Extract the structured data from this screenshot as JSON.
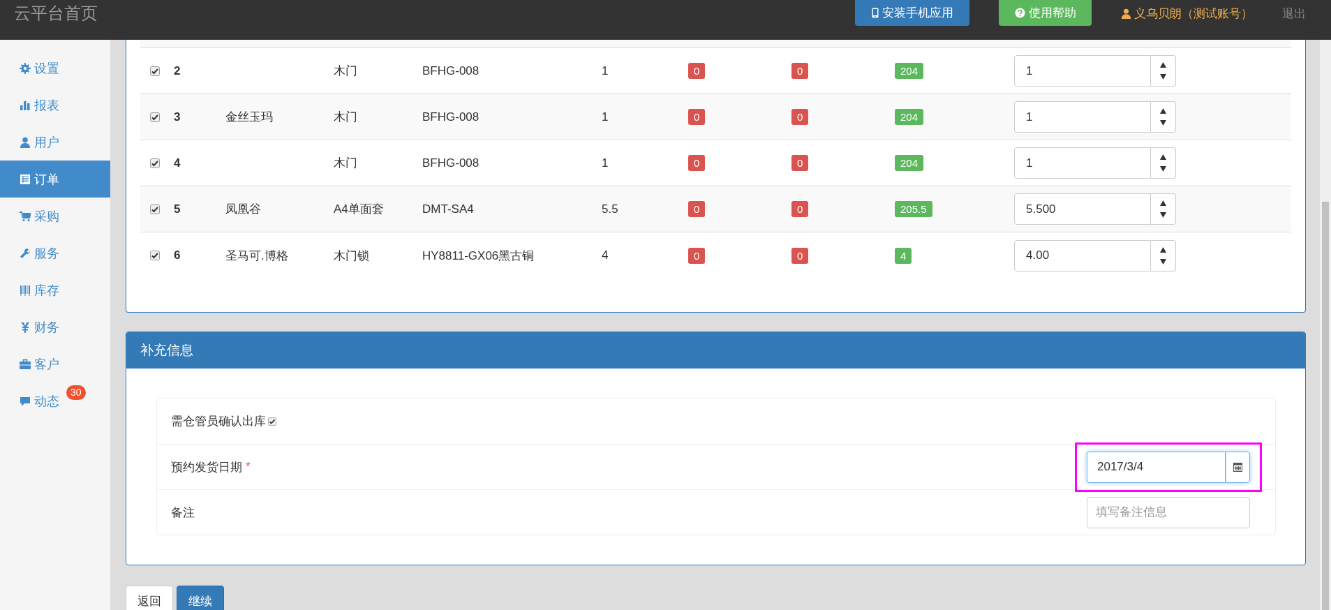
{
  "header": {
    "title": "云平台首页",
    "buttons": [
      {
        "label": "安装手机应用",
        "kind": "primary"
      },
      {
        "label": "使用帮助",
        "kind": "success"
      }
    ],
    "user": "义乌贝朗（测试账号）",
    "logout": "退出"
  },
  "sidebar": {
    "items": [
      {
        "label": "设置",
        "kind": "settings",
        "selected": false
      },
      {
        "label": "报表",
        "kind": "reports",
        "selected": false
      },
      {
        "label": "用户",
        "kind": "users",
        "selected": false
      },
      {
        "label": "订单",
        "kind": "orders",
        "selected": true
      },
      {
        "label": "采购",
        "kind": "purchase",
        "selected": false
      },
      {
        "label": "服务",
        "kind": "service",
        "selected": false
      },
      {
        "label": "库存",
        "kind": "stock",
        "selected": false
      },
      {
        "label": "财务",
        "kind": "finance",
        "selected": false
      },
      {
        "label": "客户",
        "kind": "clients",
        "selected": false
      },
      {
        "label": "动态",
        "kind": "news",
        "selected": false,
        "badge": "30"
      }
    ]
  },
  "table": {
    "rows": [
      {
        "checked": true,
        "number": "2",
        "name": "",
        "type": "木门",
        "code": "BFHG-008",
        "quantity": "1",
        "stock_a": "0",
        "stock_b": "0",
        "available": "204",
        "amount": "1"
      },
      {
        "checked": true,
        "number": "3",
        "name": "金丝玉玛",
        "type": "木门",
        "code": "BFHG-008",
        "quantity": "1",
        "stock_a": "0",
        "stock_b": "0",
        "available": "204",
        "amount": "1"
      },
      {
        "checked": true,
        "number": "4",
        "name": "",
        "type": "木门",
        "code": "BFHG-008",
        "quantity": "1",
        "stock_a": "0",
        "stock_b": "0",
        "available": "204",
        "amount": "1"
      },
      {
        "checked": true,
        "number": "5",
        "name": "凤凰谷",
        "type": "A4单面套",
        "code": "DMT-SA4",
        "quantity": "5.5",
        "stock_a": "0",
        "stock_b": "0",
        "available": "205.5",
        "amount": "5.500"
      },
      {
        "checked": true,
        "number": "6",
        "name": "圣马可.博格",
        "type": "木门锁",
        "code": "HY8811-GX06黑古铜",
        "quantity": "4",
        "stock_a": "0",
        "stock_b": "0",
        "available": "4",
        "amount": "4.00"
      }
    ]
  },
  "extra": {
    "title": "补充信息",
    "fields": [
      {
        "kind": "checkbox",
        "label": "需仓管员确认出库",
        "checked": true
      },
      {
        "kind": "date",
        "label": "预约发货日期",
        "required_mark": "*",
        "value": "2017/3/4",
        "highlighted": true
      },
      {
        "kind": "text",
        "label": "备注",
        "placeholder": "填写备注信息"
      }
    ]
  },
  "actions": [
    {
      "label": "返回",
      "kind": "default"
    },
    {
      "label": "继续",
      "kind": "primary"
    }
  ]
}
